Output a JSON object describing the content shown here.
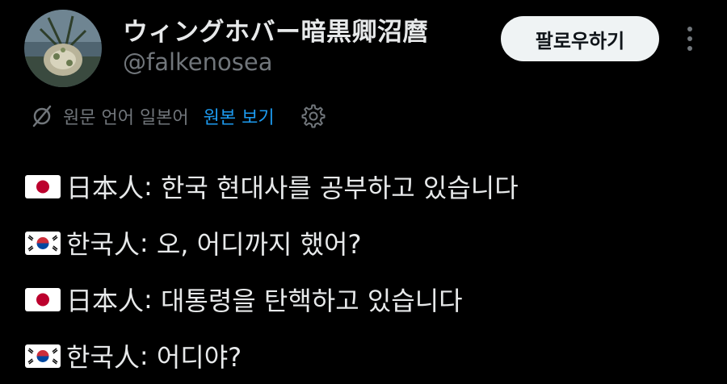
{
  "author": {
    "display_name": "ウィングホバー暗黒卿沼麿",
    "handle": "@falkenosea"
  },
  "actions": {
    "follow_label": "팔로우하기",
    "more_icon": "more-vertical-icon"
  },
  "translation": {
    "label": "원문 언어 일본어",
    "show_original": "원본 보기",
    "translate_icon": "translate-icon",
    "settings_icon": "gear-icon"
  },
  "tweet": {
    "lines": [
      {
        "flag": "japan-flag-icon",
        "speaker": "日本人",
        "sep": ":",
        "text": " 한국 현대사를 공부하고 있습니다"
      },
      {
        "flag": "korea-flag-icon",
        "speaker": "한국人",
        "sep": ":",
        "text": " 오, 어디까지 했어?"
      },
      {
        "flag": "japan-flag-icon",
        "speaker": "日本人",
        "sep": ":",
        "text": " 대통령을 탄핵하고 있습니다"
      },
      {
        "flag": "korea-flag-icon",
        "speaker": "한국人",
        "sep": ":",
        "text": " 어디야?"
      }
    ]
  },
  "colors": {
    "background": "#000000",
    "text_primary": "#e7e9ea",
    "text_secondary": "#71767b",
    "link": "#1d9bf0",
    "button_bg": "#eff3f4"
  }
}
